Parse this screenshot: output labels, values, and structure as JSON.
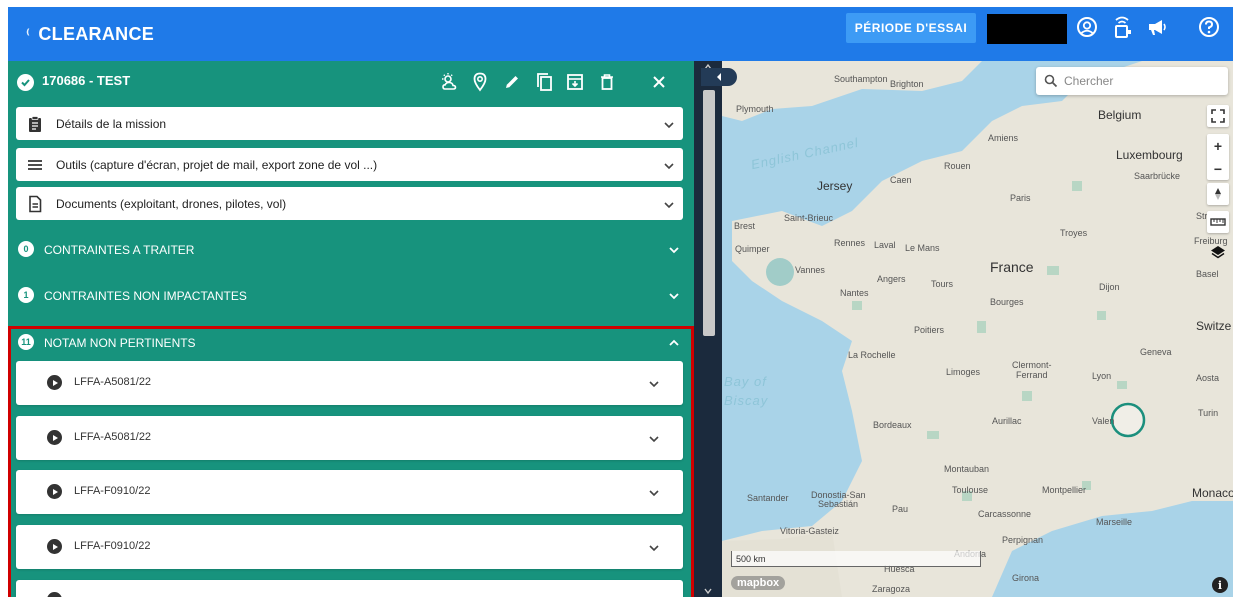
{
  "app": {
    "brand": "CLEARANCE",
    "trial_label": "PÉRIODE D'ESSAI",
    "colors": {
      "topbar": "#1f7ae8",
      "panel": "#17937d",
      "highlight": "#d00000"
    }
  },
  "mission": {
    "title": "170686 - TEST",
    "header_icons": [
      "weather-icon",
      "location-pin-icon",
      "edit-pencil-icon",
      "copy-icon",
      "archive-icon",
      "trash-icon",
      "close-icon"
    ]
  },
  "cards": [
    {
      "label": "Détails de la mission",
      "icon": "clipboard-icon"
    },
    {
      "label": "Outils (capture d'écran, projet de mail, export zone de vol ...)",
      "icon": "menu-lines-icon"
    },
    {
      "label": "Documents (exploitant, drones, pilotes, vol)",
      "icon": "document-icon"
    }
  ],
  "sections": [
    {
      "count": "0",
      "label": "CONTRAINTES A TRAITER"
    },
    {
      "count": "1",
      "label": "CONTRAINTES NON IMPACTANTES"
    },
    {
      "count": "11",
      "label": "NOTAM NON PERTINENTS"
    }
  ],
  "notams": [
    {
      "label": "LFFA-A5081/22"
    },
    {
      "label": "LFFA-A5081/22"
    },
    {
      "label": "LFFA-F0910/22"
    },
    {
      "label": "LFFA-F0910/22"
    }
  ],
  "map": {
    "search_placeholder": "Chercher",
    "scale_label": "500 km",
    "logo": "mapbox",
    "labels": {
      "southampton": "Southampton",
      "brighton": "Brighton",
      "plymouth": "Plymouth",
      "belgium": "Belgium",
      "english_channel": "English Channel",
      "amiens": "Amiens",
      "luxembourg": "Luxembourg",
      "saarbrucke": "Saarbrücke",
      "rouen": "Rouen",
      "caen": "Caen",
      "jersey": "Jersey",
      "paris": "Paris",
      "brest": "Brest",
      "saint_brieuc": "Saint-Brieuc",
      "rennes": "Rennes",
      "laval": "Laval",
      "le_mans": "Le Mans",
      "troyes": "Troyes",
      "quimper": "Quimper",
      "france": "France",
      "vannes": "Vannes",
      "angers": "Angers",
      "tours": "Tours",
      "dijon": "Dijon",
      "nantes": "Nantes",
      "bourges": "Bourges",
      "basel": "Basel",
      "poitiers": "Poitiers",
      "switze": "Switze",
      "la_rochelle": "La Rochelle",
      "geneva": "Geneva",
      "limoges": "Limoges",
      "clermont": "Clermont-",
      "ferrand": "Ferrand",
      "lyon": "Lyon",
      "aosta": "Aosta",
      "bay_of": "Bay of",
      "biscay": "Biscay",
      "turin": "Turin",
      "bordeaux": "Bordeaux",
      "aurillac": "Aurillac",
      "valence": "Valen",
      "montauban": "Montauban",
      "toulouse": "Toulouse",
      "montpellier": "Montpellier",
      "monaco": "Monaco",
      "santander": "Santander",
      "donostia": "Donostia-San",
      "sebastian": "Sebastián",
      "pau": "Pau",
      "carcassonne": "Carcassonne",
      "marseille": "Marseille",
      "vitoria": "Vitoria-Gasteiz",
      "perpignan": "Perpignan",
      "andorra": "Andorra",
      "huesca": "Huesca",
      "girona": "Girona",
      "zaragoza": "Zaragoza",
      "freiburg": "Freiburg",
      "stra": "Stra"
    }
  }
}
